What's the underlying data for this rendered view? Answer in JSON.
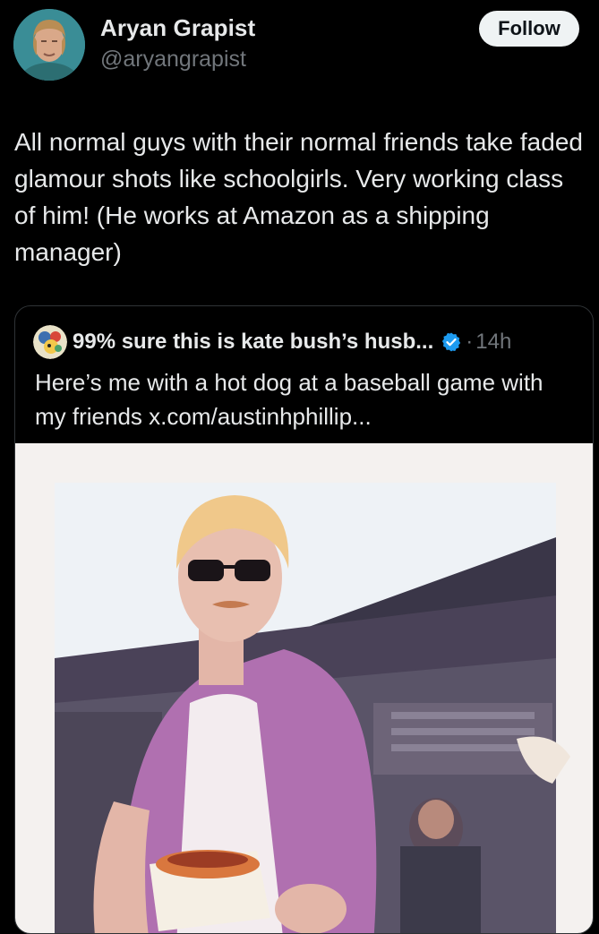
{
  "author": {
    "display_name": "Aryan Grapist",
    "handle": "@aryangrapist"
  },
  "follow_label": "Follow",
  "tweet": {
    "text": "All normal guys with their normal friends take faded glamour shots like schoolgirls. Very working class of him! (He works at Amazon as a shipping manager)"
  },
  "quoted": {
    "display_name": "99% sure this is kate bush’s husb...",
    "separator": "·",
    "time": "14h",
    "text": "Here’s me with a hot dog at a baseball game with my friends x.com/austinhphillip..."
  },
  "icons": {
    "verified": "verified-badge-icon",
    "avatar": "avatar-photo",
    "quoted_avatar": "quoted-avatar-illustration"
  },
  "colors": {
    "background": "#000000",
    "text_primary": "#e7e9ea",
    "text_secondary": "#71767b",
    "verified_blue": "#1d9bf0",
    "card_border": "#2f3336",
    "follow_bg": "#eff3f4"
  }
}
